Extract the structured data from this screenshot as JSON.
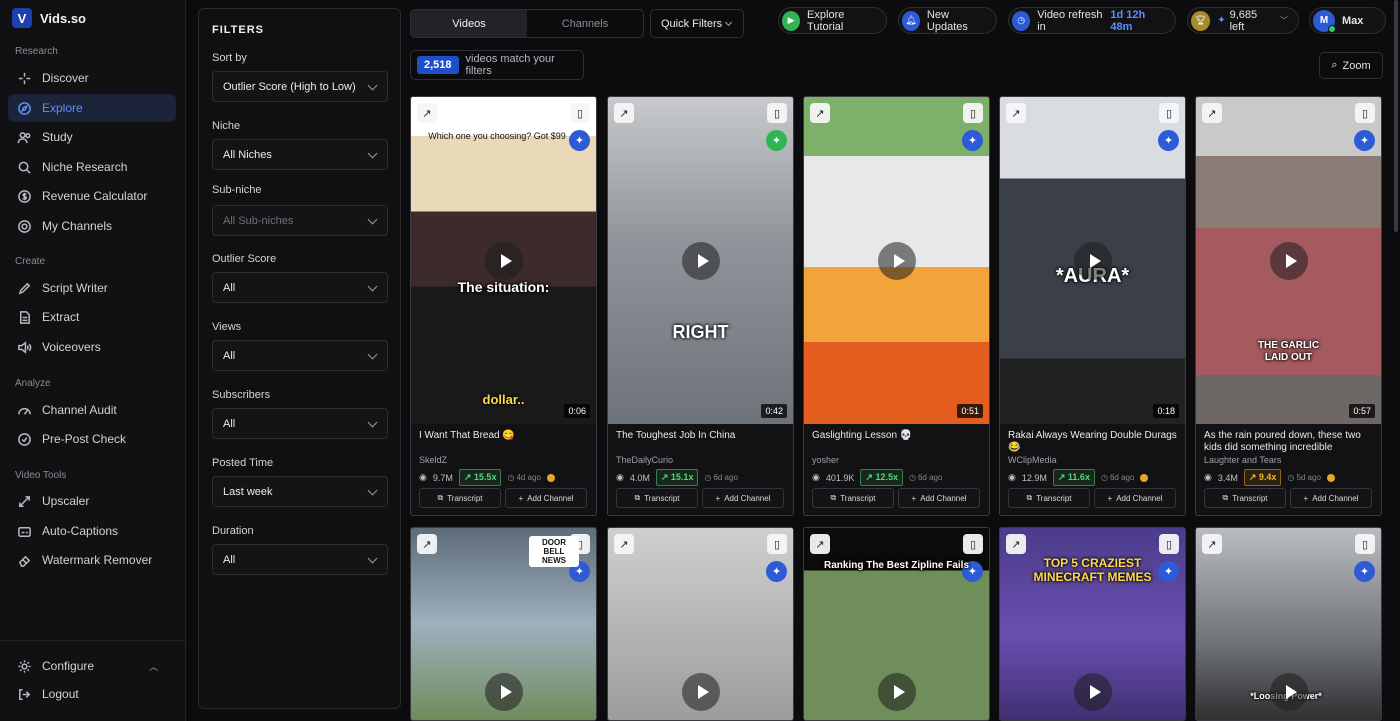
{
  "brand": {
    "name": "Vids.so",
    "logo_letter": "V"
  },
  "sidebar": {
    "sections": {
      "research": "Research",
      "create": "Create",
      "analyze": "Analyze",
      "video_tools": "Video Tools"
    },
    "items": [
      {
        "label": "Discover",
        "icon": "sparkles-icon"
      },
      {
        "label": "Explore",
        "icon": "compass-icon",
        "active": true
      },
      {
        "label": "Study",
        "icon": "users-icon"
      },
      {
        "label": "Niche Research",
        "icon": "search-icon"
      },
      {
        "label": "Revenue Calculator",
        "icon": "dollar-icon"
      },
      {
        "label": "My Channels",
        "icon": "target-icon"
      },
      {
        "label": "Script Writer",
        "icon": "pen-icon"
      },
      {
        "label": "Extract",
        "icon": "document-icon"
      },
      {
        "label": "Voiceovers",
        "icon": "speaker-icon"
      },
      {
        "label": "Channel Audit",
        "icon": "gauge-icon"
      },
      {
        "label": "Pre-Post Check",
        "icon": "badge-check-icon"
      },
      {
        "label": "Upscaler",
        "icon": "expand-icon"
      },
      {
        "label": "Auto-Captions",
        "icon": "captions-icon"
      },
      {
        "label": "Watermark Remover",
        "icon": "eraser-icon"
      }
    ],
    "configure": "Configure",
    "logout": "Logout"
  },
  "filters": {
    "title": "FILTERS",
    "sort_by": {
      "label": "Sort by",
      "value": "Outlier Score (High to Low)"
    },
    "niche": {
      "label": "Niche",
      "value": "All Niches"
    },
    "sub_niche": {
      "label": "Sub-niche",
      "value": "All Sub-niches"
    },
    "outlier_score": {
      "label": "Outlier Score",
      "value": "All"
    },
    "views": {
      "label": "Views",
      "value": "All"
    },
    "subscribers": {
      "label": "Subscribers",
      "value": "All"
    },
    "posted_time": {
      "label": "Posted Time",
      "value": "Last week"
    },
    "duration": {
      "label": "Duration",
      "value": "All"
    }
  },
  "topbar": {
    "tabs": [
      "Videos",
      "Channels"
    ],
    "quick_filters": "Quick Filters",
    "explore_tutorial": "Explore Tutorial",
    "new_updates": "New Updates",
    "refresh_prefix": "Video refresh in",
    "refresh_time": "1d 12h 48m",
    "credits": "9,685 left",
    "user": {
      "initial": "M",
      "name": "Max"
    },
    "zoom": "Zoom"
  },
  "results": {
    "count": "2,518",
    "suffix": "videos match your filters"
  },
  "cards": [
    {
      "title": "I Want That Bread 😋",
      "channel": "SkeldZ",
      "views": "9.7M",
      "outlier": "15.5x",
      "ago": "4d ago",
      "duration": "0:06",
      "coin": true,
      "gold": false,
      "overlay": "The situation:",
      "overlay2": "dollar..",
      "top_text": "Which one you choosing? Got $99"
    },
    {
      "title": "The Toughest Job In China",
      "channel": "TheDailyCurio",
      "views": "4.0M",
      "outlier": "15.1x",
      "ago": "6d ago",
      "duration": "0:42",
      "coin": false,
      "gold": false,
      "overlay": "RIGHT"
    },
    {
      "title": "Gaslighting Lesson 💀",
      "channel": "yosher",
      "views": "401.9K",
      "outlier": "12.5x",
      "ago": "6d ago",
      "duration": "0:51",
      "coin": false,
      "gold": false
    },
    {
      "title": "Rakai Always Wearing Double Durags 😂",
      "channel": "WClipMedia",
      "views": "12.9M",
      "outlier": "11.6x",
      "ago": "6d ago",
      "duration": "0:18",
      "coin": true,
      "gold": false,
      "overlay": "*AURA*"
    },
    {
      "title": "As the rain poured down, these two kids did something incredible",
      "channel": "Laughter and Tears",
      "views": "3.4M",
      "outlier": "9.4x",
      "ago": "5d ago",
      "duration": "0:57",
      "coin": true,
      "gold": true,
      "overlay": "THE GARLIC LAID OUT"
    }
  ],
  "row2": [
    {
      "overlay": "DOOR BELL NEWS"
    },
    {
      "overlay": ""
    },
    {
      "overlay": "Ranking The Best Zipline Fails"
    },
    {
      "overlay": "TOP 5 CRAZIEST MINECRAFT MEMES"
    },
    {
      "overlay": "*Loosing Power*"
    }
  ],
  "labels": {
    "transcript": "Transcript",
    "add_channel": "Add Channel"
  },
  "colors": {
    "accent": "#5b8dff",
    "outlier_green": "#58d27a",
    "outlier_gold": "#f1b531",
    "badge_blue": "#1e4fc9"
  }
}
